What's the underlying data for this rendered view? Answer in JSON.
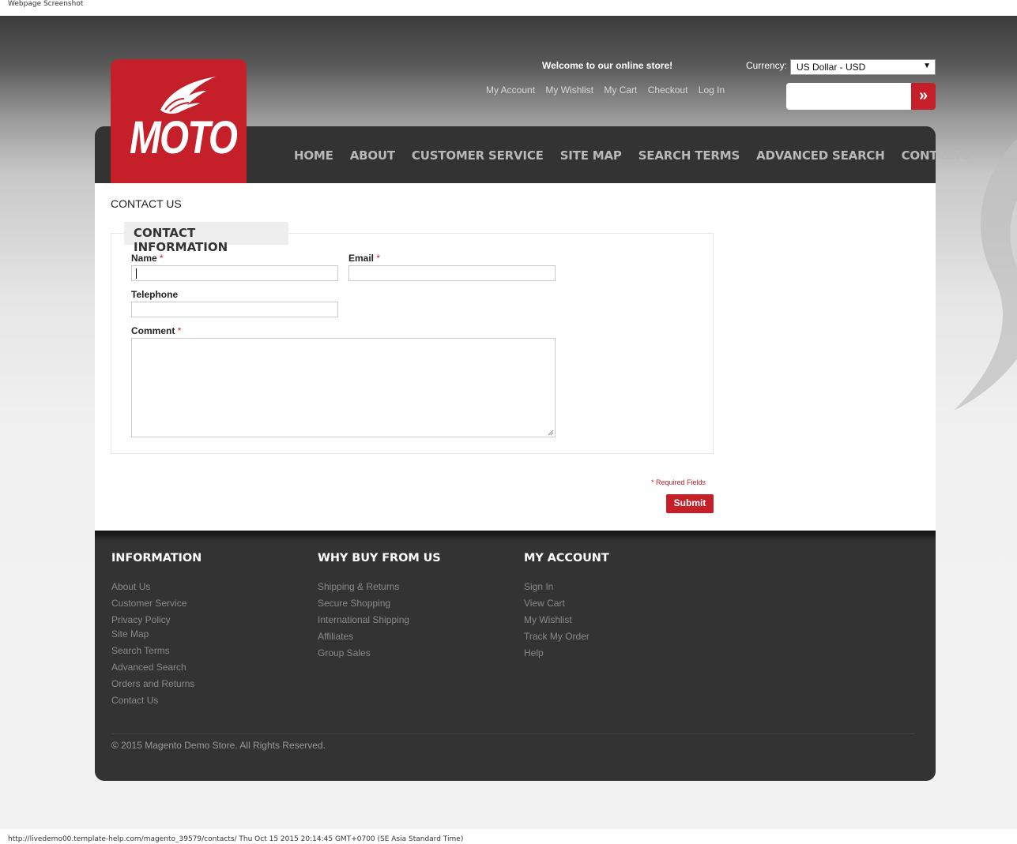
{
  "capture": {
    "top_caption": "Webpage Screenshot",
    "bottom_caption": "http://livedemo00.template-help.com/magento_39579/contacts/ Thu Oct 15 2015 20:14:45 GMT+0700 (SE Asia Standard Time)"
  },
  "header": {
    "logo_text": "MOTO",
    "welcome": "Welcome to our online store!",
    "currency_label": "Currency:",
    "currency_value": "US Dollar - USD",
    "toplinks": [
      "My Account",
      "My Wishlist",
      "My Cart",
      "Checkout",
      "Log In"
    ],
    "search_placeholder": "",
    "search_button_icon": "double-chevron-right-icon"
  },
  "nav": [
    "HOME",
    "ABOUT",
    "CUSTOMER SERVICE",
    "SITE MAP",
    "SEARCH TERMS",
    "ADVANCED SEARCH",
    "CONTACTS"
  ],
  "main": {
    "page_title": "CONTACT US",
    "legend": "CONTACT INFORMATION",
    "fields": {
      "name_label": "Name",
      "email_label": "Email",
      "telephone_label": "Telephone",
      "comment_label": "Comment",
      "required_mark": "*",
      "name_value": "",
      "email_value": "",
      "telephone_value": "",
      "comment_value": ""
    },
    "required_note": "* Required Fields",
    "submit_label": "Submit"
  },
  "footer": {
    "columns": [
      {
        "title": "INFORMATION",
        "links": [
          "About Us",
          "Customer Service",
          "Privacy Policy",
          "Site Map",
          "Search Terms",
          "Advanced Search",
          "Orders and Returns",
          "Contact Us"
        ]
      },
      {
        "title": "WHY BUY FROM US",
        "links": [
          "Shipping & Returns",
          "Secure Shopping",
          "International Shipping",
          "Affiliates",
          "Group Sales"
        ]
      },
      {
        "title": "MY ACCOUNT",
        "links": [
          "Sign In",
          "View Cart",
          "My Wishlist",
          "Track My Order",
          "Help"
        ]
      }
    ],
    "copyright": "© 2015 Magento Demo Store. All Rights Reserved."
  },
  "colors": {
    "brand_red": "#c5202a",
    "dark": "#333333",
    "nav_text": "#b8b8b8"
  }
}
